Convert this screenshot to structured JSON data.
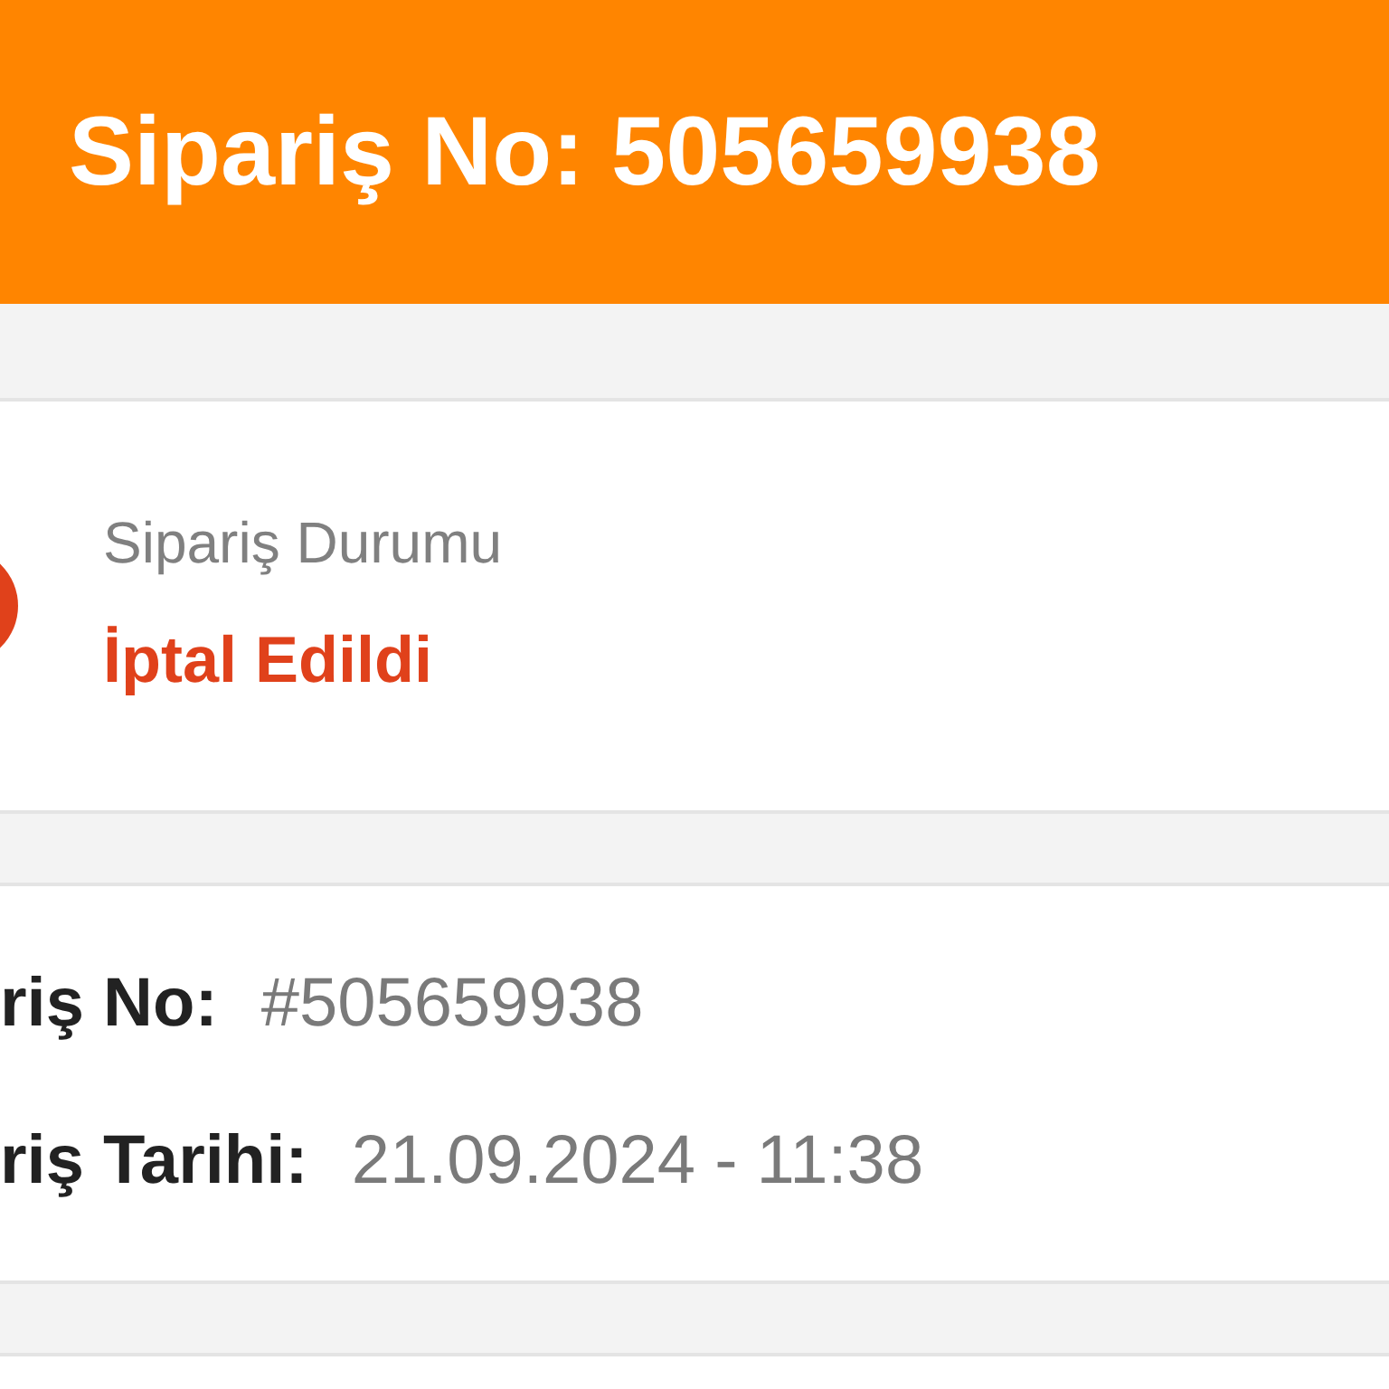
{
  "header": {
    "title": "Sipariş No: 505659938"
  },
  "status": {
    "label": "Sipariş Durumu",
    "value": "İptal Edildi",
    "color": "#e0411b"
  },
  "details": [
    {
      "label": "riş No:",
      "value": "#505659938"
    },
    {
      "label": "riş Tarihi:",
      "value": "21.09.2024 - 11:38"
    }
  ]
}
